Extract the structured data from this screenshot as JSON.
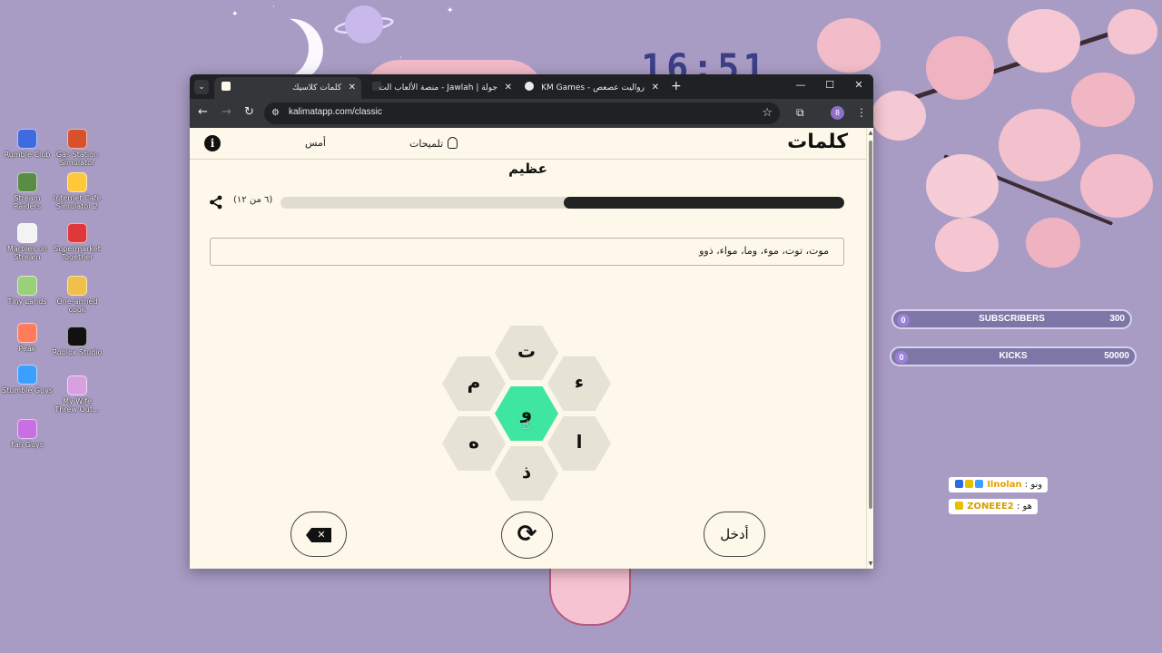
{
  "desktop": {
    "clock": "16:51",
    "icons": [
      {
        "label": "Rumble Club",
        "color": "#3f6be0"
      },
      {
        "label": "Gas Station Simulator",
        "color": "#d9502c"
      },
      {
        "label": "Stream Raiders",
        "color": "#5a8c46"
      },
      {
        "label": "Internet Cafe Simulator 2",
        "color": "#ffc73a"
      },
      {
        "label": "Marbles on Stream",
        "color": "#f3f3f3"
      },
      {
        "label": "Supermarket Together",
        "color": "#e0383a"
      },
      {
        "label": "Tiny Lands",
        "color": "#9ad07a"
      },
      {
        "label": "One-armed cook",
        "color": "#efc04a"
      },
      {
        "label": "Peak",
        "color": "#ff7b5c"
      },
      {
        "label": "Roblox Studio",
        "color": "#111111"
      },
      {
        "label": "Stumble Guys",
        "color": "#3aa0ff"
      },
      {
        "label": "My Wife Threw Out...",
        "color": "#d8a0e0"
      },
      {
        "label": "Fall Guys",
        "color": "#c86fe2"
      }
    ]
  },
  "stream_overlay": {
    "goals": [
      {
        "title": "SUBSCRIBERS",
        "current": "0",
        "target": "300"
      },
      {
        "title": "KICKS",
        "current": "0",
        "target": "50000"
      }
    ],
    "chat": [
      {
        "username": "Ilnolan",
        "message": "ونو"
      },
      {
        "username": "ZONEEE2",
        "message": "هو"
      }
    ]
  },
  "browser": {
    "tabs": [
      {
        "label": "كلمات كلاسيك",
        "active": true
      },
      {
        "label": "جولة | Jawlah - منصة الألعاب الت",
        "active": false
      },
      {
        "label": "رواليت عصعص - KM Games",
        "active": false
      }
    ],
    "url": "kalimatapp.com/classic",
    "profile_initial": "8"
  },
  "app": {
    "logo": "كلمات",
    "hints_label": "تلميحات",
    "yesterday_label": "أمس",
    "info_symbol": "i",
    "rank_label": "عظيم",
    "found_count": "(٦ من ١٢)",
    "progress_fraction": 0.498,
    "found_words": "موت، توت، موء، وما، مواء، ذوو",
    "letters": {
      "center": "و",
      "top": "ت",
      "upper_left": "م",
      "upper_right": "ء",
      "lower_left": "ه",
      "lower_right": "ا",
      "bottom": "ذ"
    },
    "delete_symbol": "✕",
    "shuffle_symbol": "⟳",
    "enter_label": "أدخل"
  }
}
